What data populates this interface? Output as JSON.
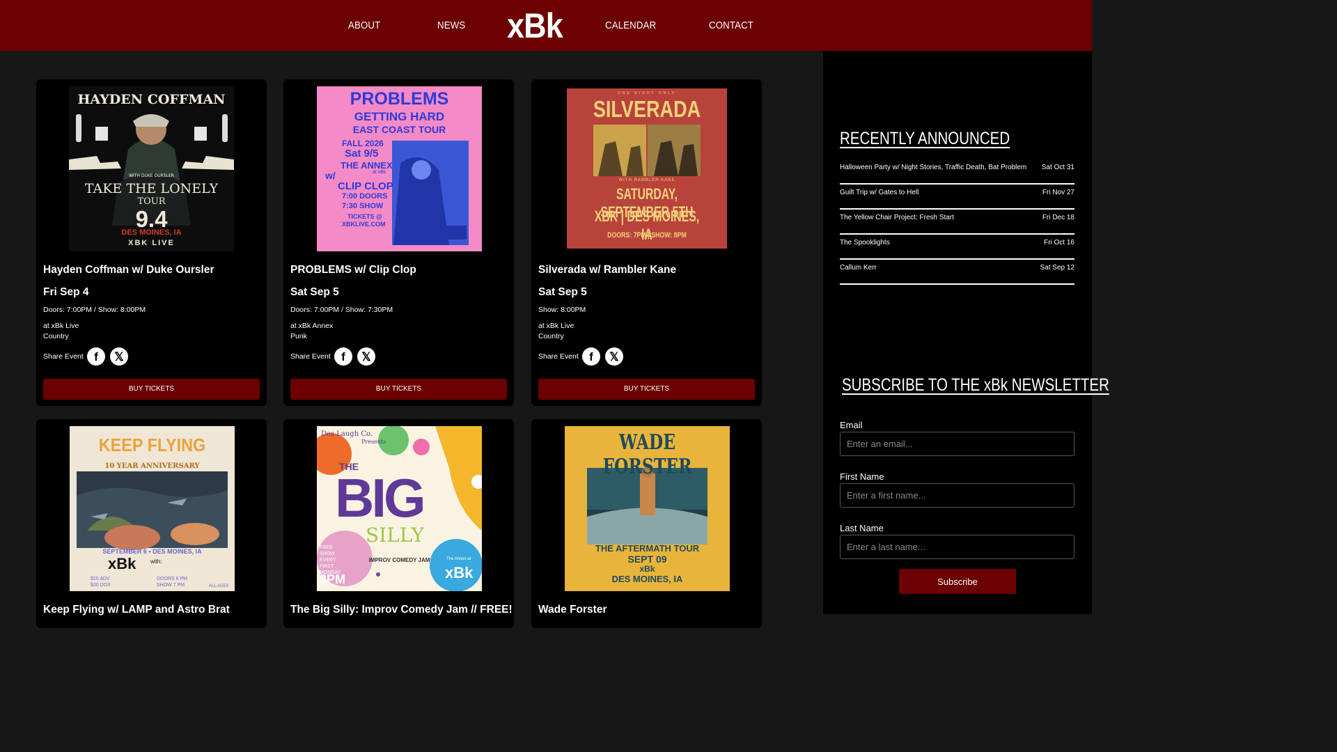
{
  "nav": {
    "about": "ABOUT",
    "news": "NEWS",
    "logo": "xBk",
    "calendar": "CALENDAR",
    "contact": "CONTACT"
  },
  "events": [
    {
      "title": "Hayden Coffman w/ Duke Oursler",
      "date": "Fri Sep 4",
      "time": "Doors: 7:00PM / Show: 8:00PM",
      "venue": "at xBk Live",
      "genre": "Country",
      "share_label": "Share Event",
      "buy_label": "BUY TICKETS",
      "poster": {
        "line1": "HAYDEN COFFMAN",
        "line2": "WITH DUKE OURSLER",
        "line3": "TAKE THE LONELY",
        "line4": "TOUR",
        "line5": "9.4",
        "line6": "DES MOINES, IA",
        "line7": "XBK LIVE"
      }
    },
    {
      "title": "PROBLEMS w/ Clip Clop",
      "date": "Sat Sep 5",
      "time": "Doors: 7:00PM / Show: 7:30PM",
      "venue": "at xBk Annex",
      "genre": "Punk",
      "share_label": "Share Event",
      "buy_label": "BUY TICKETS",
      "poster": {
        "line1": "PROBLEMS",
        "line2": "GETTING HARD",
        "line3": "EAST COAST TOUR",
        "line4": "FALL 2026",
        "line5": "Sat 9/5",
        "line6": "THE ANNEX",
        "line7": "at xBk",
        "line8": "w/",
        "line9": "CLIP CLOP",
        "line10": "7:00 DOORS",
        "line11": "7:30 SHOW",
        "line12": "TICKETS @",
        "line13": "XBKLIVE.COM"
      }
    },
    {
      "title": "Silverada w/ Rambler Kane",
      "date": "Sat Sep 5",
      "time": "Show: 8:00PM",
      "venue": "at xBk Live",
      "genre": "Country",
      "share_label": "Share Event",
      "buy_label": "BUY TICKETS",
      "poster": {
        "line0": "ONE NIGHT ONLY",
        "line1": "SILVERADA",
        "line2": "WITH RAMBLER KANE",
        "line3": "SATURDAY, SEPTEMBER 5TH",
        "line4": "XBK | DES MOINES, IA",
        "line5": "DOORS: 7PM | SHOW: 8PM"
      }
    },
    {
      "title": "Keep Flying w/ LAMP and Astro Brat",
      "poster": {
        "line1": "KEEP FLYING",
        "line2": "10 YEAR ANNIVERSARY",
        "line3": "SEPTEMBER 6 • DES MOINES, IA",
        "line4": "xBk",
        "line5": "with:",
        "line6": "$15 ADV",
        "line7": "$20 DOS",
        "line8": "DOORS 6 PM",
        "line9": "SHOW 7 PM",
        "line10": "ALL AGES"
      }
    },
    {
      "title": "The Big Silly: Improv Comedy Jam // FREE!",
      "poster": {
        "line1": "Des Laugh Co.",
        "line2": "Presents",
        "line3": "THE",
        "line4": "BIG",
        "line5": "SILLY",
        "line6": "IMPROV COMEDY JAM",
        "line7": "FREE SHOW EVERY FIRST MONDAY",
        "line8": "8PM",
        "line9": "The Annex at",
        "line10": "xBk"
      }
    },
    {
      "title": "Wade Forster",
      "poster": {
        "line1": "WADE FORSTER",
        "line2": "THE AFTERMATH TOUR",
        "line3": "SEPT 09",
        "line4": "xBk",
        "line5": "DES MOINES, IA"
      }
    }
  ],
  "sidebar": {
    "recently_announced_heading": "RECENTLY ANNOUNCED",
    "recently_announced": [
      {
        "name": "Halloween Party w/ Night Stories, Traffic Death, Bat Problem",
        "date": "Sat Oct 31"
      },
      {
        "name": "Guilt Trip w/ Gates to Hell",
        "date": "Fri Nov 27"
      },
      {
        "name": "The Yellow Chair Project: Fresh Start",
        "date": "Fri Dec 18"
      },
      {
        "name": "The Spooklights",
        "date": "Fri Oct 16"
      },
      {
        "name": "Callum Kerr",
        "date": "Sat Sep 12"
      }
    ],
    "newsletter_heading": "SUBSCRIBE TO THE xBk NEWSLETTER",
    "email_label": "Email",
    "email_placeholder": "Enter an email...",
    "first_name_label": "First Name",
    "first_name_placeholder": "Enter a first name...",
    "last_name_label": "Last Name",
    "last_name_placeholder": "Enter a last name...",
    "subscribe_label": "Subscribe"
  },
  "colors": {
    "brand": "#6c0000",
    "page_bg": "#171717",
    "card_bg": "#000000"
  }
}
